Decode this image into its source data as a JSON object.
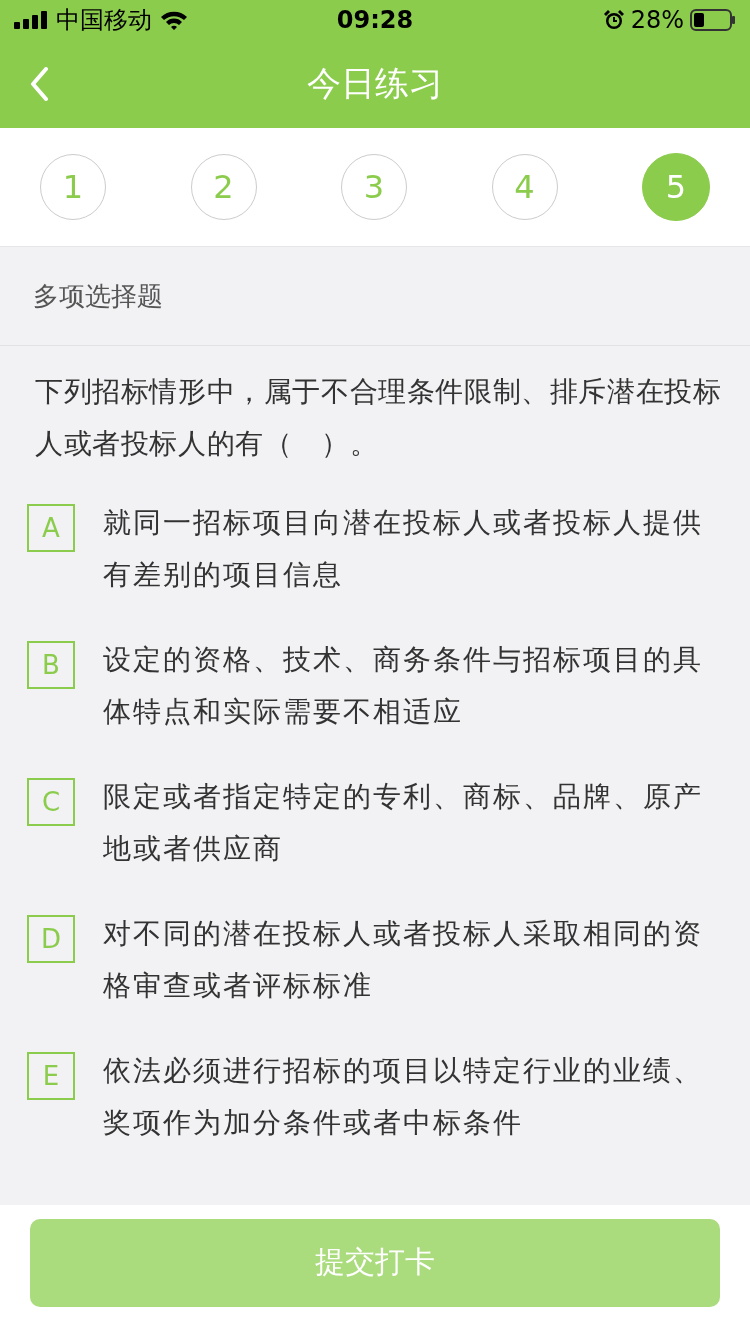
{
  "status_bar": {
    "carrier": "中国移动",
    "time": "09:28",
    "battery": "28%"
  },
  "header": {
    "title": "今日练习"
  },
  "steps": [
    {
      "label": "1",
      "selected": false
    },
    {
      "label": "2",
      "selected": false
    },
    {
      "label": "3",
      "selected": false
    },
    {
      "label": "4",
      "selected": false
    },
    {
      "label": "5",
      "selected": true
    }
  ],
  "question": {
    "type_label": "多项选择题",
    "text": "下列招标情形中，属于不合理条件限制、排斥潜在投标人或者投标人的有（　）。",
    "options": [
      {
        "letter": "A",
        "text": "就同一招标项目向潜在投标人或者投标人提供有差别的项目信息",
        "selected": false
      },
      {
        "letter": "B",
        "text": "设定的资格、技术、商务条件与招标项目的具体特点和实际需要不相适应",
        "selected": false
      },
      {
        "letter": "C",
        "text": "限定或者指定特定的专利、商标、品牌、原产地或者供应商",
        "selected": false
      },
      {
        "letter": "D",
        "text": "对不同的潜在投标人或者投标人采取相同的资格审查或者评标标准",
        "selected": false
      },
      {
        "letter": "E",
        "text": "依法必须进行招标的项目以特定行业的业绩、奖项作为加分条件或者中标条件",
        "selected": false
      }
    ]
  },
  "submit_button": {
    "label": "提交打卡",
    "disabled": true
  }
}
